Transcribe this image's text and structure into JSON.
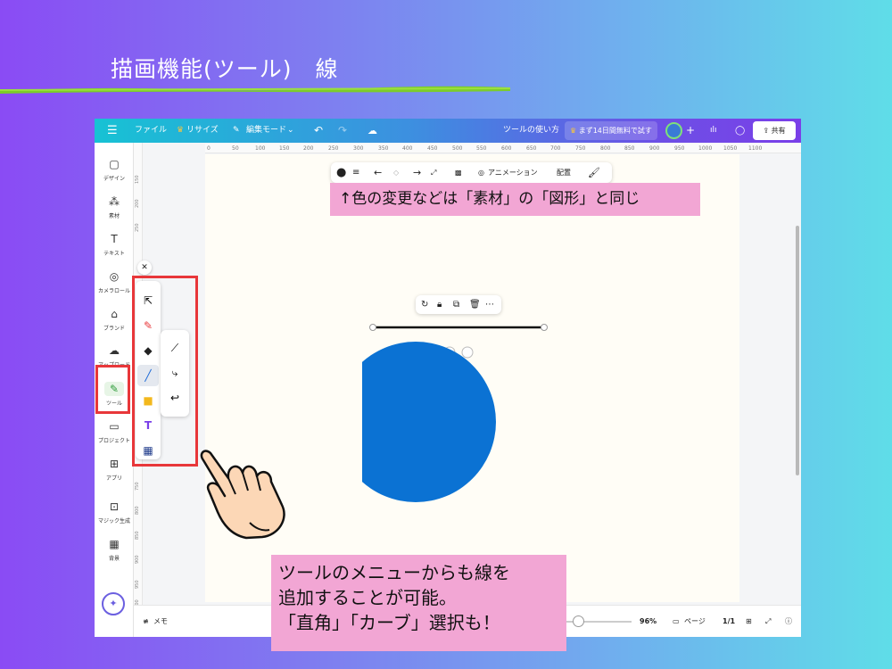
{
  "slide": {
    "title": "描画機能(ツール)　線",
    "note_top": "↑色の変更などは「素材」の「図形」と同じ",
    "note_bottom": [
      "ツールのメニューからも線を",
      "追加することが可能。",
      "「直角」「カーブ」選択も！"
    ],
    "colors": {
      "accent_stroke": "#7ccc2a",
      "highlight_red": "#e8373a",
      "note_bg": "#f2a6d4",
      "circle_fill": "#0b72d3"
    }
  },
  "topbar": {
    "menu_icon": "hamburger-icon",
    "file": "ファイル",
    "resize": "リサイズ",
    "edit_mode": "編集モード",
    "undo_icon": "undo-icon",
    "redo_icon": "redo-icon",
    "cloud_icon": "cloud-sync-icon",
    "howto": "ツールの使い方",
    "trial": "まず14日間無料で試す",
    "share": "共有"
  },
  "sidebar": {
    "items": [
      {
        "label": "デザイン",
        "icon": "design-icon"
      },
      {
        "label": "素材",
        "icon": "elements-icon"
      },
      {
        "label": "テキスト",
        "icon": "text-icon"
      },
      {
        "label": "カメラロール",
        "icon": "camera-icon"
      },
      {
        "label": "ブランド",
        "icon": "brand-icon"
      },
      {
        "label": "アップロード",
        "icon": "upload-icon"
      },
      {
        "label": "ツール",
        "icon": "tools-icon"
      },
      {
        "label": "プロジェクト",
        "icon": "folder-icon"
      },
      {
        "label": "アプリ",
        "icon": "apps-icon"
      },
      {
        "label": "マジック生成",
        "icon": "magic-media-icon"
      },
      {
        "label": "背景",
        "icon": "background-icon"
      }
    ]
  },
  "ruler": {
    "h": [
      "0",
      "50",
      "100",
      "150",
      "200",
      "250",
      "300",
      "350",
      "400",
      "450",
      "500",
      "550",
      "600",
      "650",
      "700",
      "750",
      "800",
      "850",
      "900",
      "950",
      "1000",
      "1050",
      "1100"
    ],
    "v": [
      "150",
      "200",
      "250",
      "750",
      "800",
      "850",
      "900",
      "950",
      "1000"
    ]
  },
  "context_toolbar": {
    "animation": "アニメーション",
    "position": "配置"
  },
  "bottombar": {
    "memo": "メモ",
    "zoom": "96%",
    "pages": "ページ",
    "page_count": "1/1"
  }
}
